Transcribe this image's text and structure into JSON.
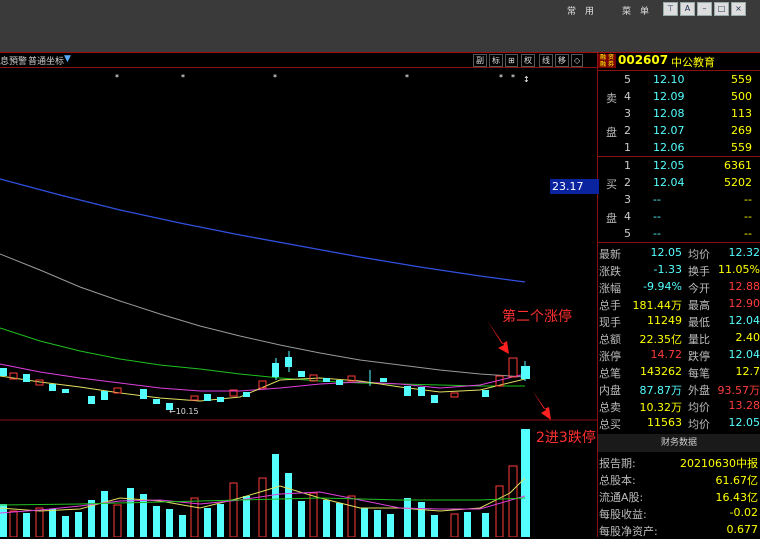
{
  "app": {
    "menu": [
      "常",
      "用",
      "菜",
      "单"
    ],
    "toolbar_left": [
      "息預警",
      "普通坐标"
    ],
    "toolbar_right": [
      "副",
      "标",
      "⊞",
      "权",
      "线",
      "移",
      "◇"
    ]
  },
  "chart": {
    "min_label": "←10.15",
    "price_tag": "23.17",
    "annotations": [
      "第二个涨停",
      "2进3跌停"
    ]
  },
  "stock": {
    "code": "002607",
    "name": "中公教育",
    "icon_text": "融 资 融 券"
  },
  "orderbook": {
    "sell_side": [
      "卖",
      "盘"
    ],
    "buy_side": [
      "买",
      "盘"
    ],
    "sell": [
      {
        "level": "5",
        "price": "12.10",
        "vol": "559"
      },
      {
        "level": "4",
        "price": "12.09",
        "vol": "500"
      },
      {
        "level": "3",
        "price": "12.08",
        "vol": "113"
      },
      {
        "level": "2",
        "price": "12.07",
        "vol": "269"
      },
      {
        "level": "1",
        "price": "12.06",
        "vol": "559"
      }
    ],
    "buy": [
      {
        "level": "1",
        "price": "12.05",
        "vol": "6361"
      },
      {
        "level": "2",
        "price": "12.04",
        "vol": "5202"
      },
      {
        "level": "3",
        "price": "--",
        "vol": "--"
      },
      {
        "level": "4",
        "price": "--",
        "vol": "--"
      },
      {
        "level": "5",
        "price": "--",
        "vol": "--"
      }
    ]
  },
  "stats": [
    {
      "l1": "最新",
      "v1": "12.05",
      "l2": "均价",
      "v2": "12.32"
    },
    {
      "l1": "涨跌",
      "v1": "-1.33",
      "l2": "换手",
      "v2": "11.05%"
    },
    {
      "l1": "涨幅",
      "v1": "-9.94%",
      "l2": "今开",
      "v2": "12.88"
    },
    {
      "l1": "总手",
      "v1": "181.44万",
      "l2": "最高",
      "v2": "12.90"
    },
    {
      "l1": "现手",
      "v1": "11249",
      "l2": "最低",
      "v2": "12.04"
    },
    {
      "l1": "总额",
      "v1": "22.35亿",
      "l2": "量比",
      "v2": "2.40"
    },
    {
      "l1": "涨停",
      "v1": "14.72",
      "l2": "跌停",
      "v2": "12.04"
    },
    {
      "l1": "总笔",
      "v1": "143262",
      "l2": "每笔",
      "v2": "12.7"
    },
    {
      "l1": "内盘",
      "v1": "87.87万",
      "l2": "外盘",
      "v2": "93.57万"
    },
    {
      "l1": "总卖",
      "v1": "10.32万",
      "l2": "均价",
      "v2": "13.28"
    },
    {
      "l1": "总买",
      "v1": "11563",
      "l2": "均价",
      "v2": "12.05"
    }
  ],
  "finance": {
    "title": "财务数据",
    "rows": [
      {
        "label": "报告期:",
        "value": "20210630中报"
      },
      {
        "label": "总股本:",
        "value": "61.67亿"
      },
      {
        "label": "流通A股:",
        "value": "16.43亿"
      },
      {
        "label": "每股收益:",
        "value": "-0.02"
      },
      {
        "label": "每股净资产:",
        "value": "0.677"
      }
    ]
  },
  "colors": {
    "up": "#ff3c3c",
    "down": "#54ffff",
    "accent": "#ffff00",
    "border": "#8b1010"
  }
}
